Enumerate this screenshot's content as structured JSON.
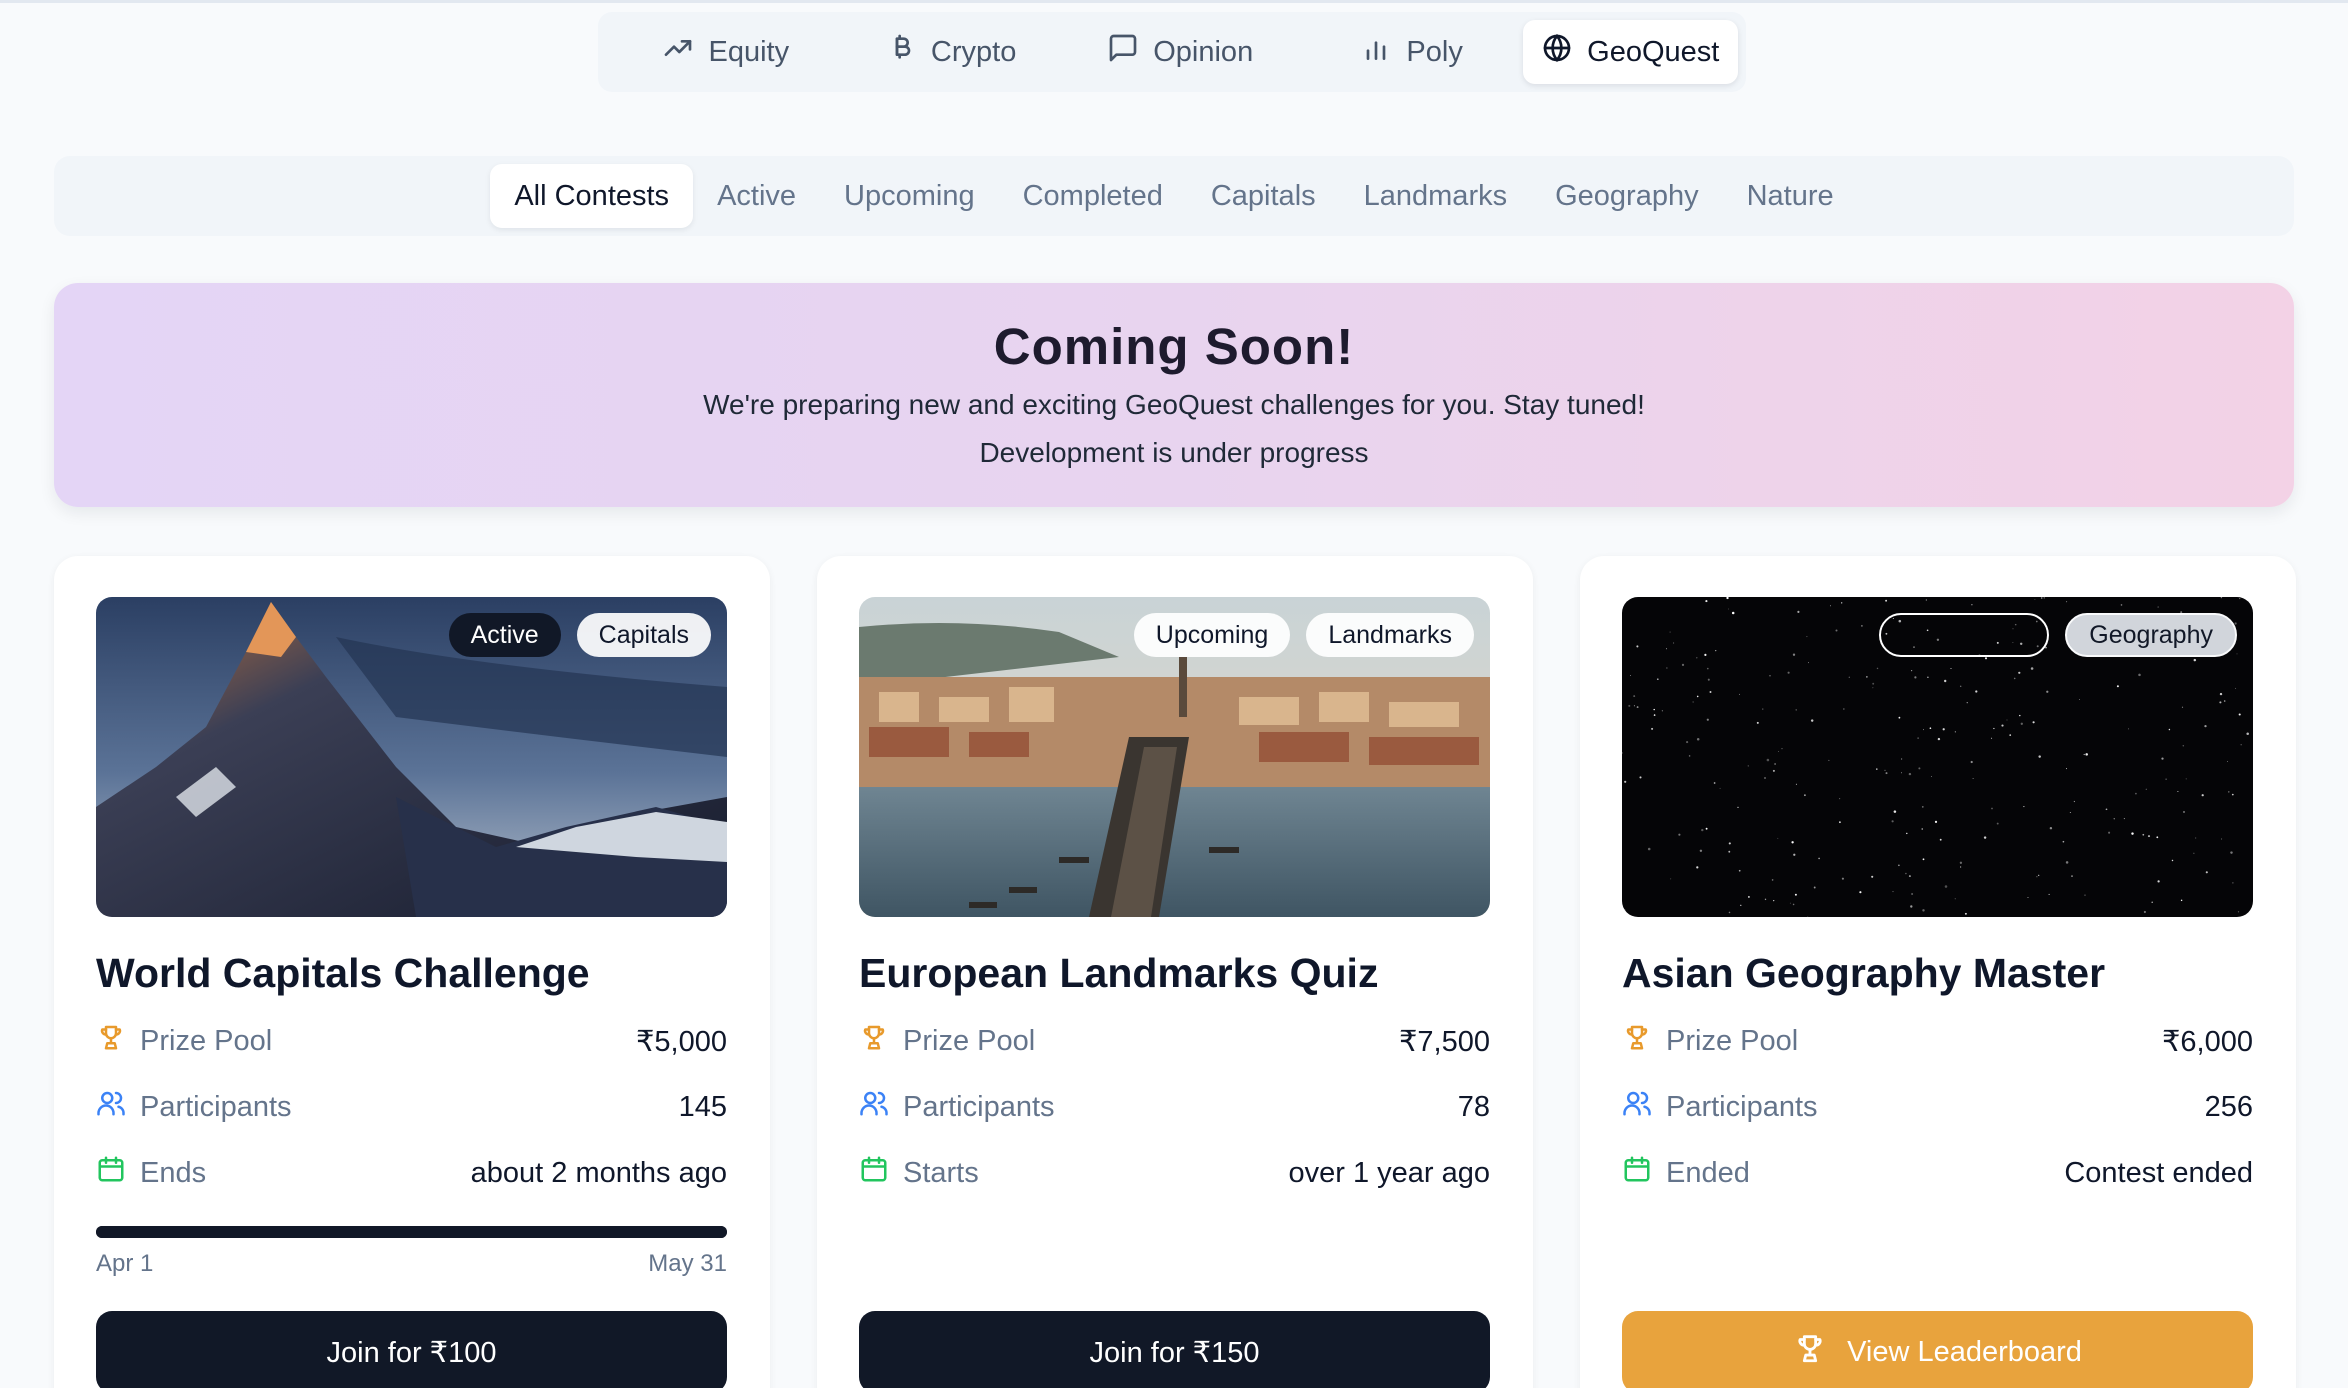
{
  "market_tabs": [
    {
      "label": "Equity",
      "icon": "trending-up-icon"
    },
    {
      "label": "Crypto",
      "icon": "bitcoin-icon"
    },
    {
      "label": "Opinion",
      "icon": "message-square-icon"
    },
    {
      "label": "Poly",
      "icon": "bar-chart-icon"
    },
    {
      "label": "GeoQuest",
      "icon": "globe-icon",
      "active": true
    }
  ],
  "filter_tabs": [
    "All Contests",
    "Active",
    "Upcoming",
    "Completed",
    "Capitals",
    "Landmarks",
    "Geography",
    "Nature"
  ],
  "active_filter": "All Contests",
  "banner": {
    "title": "Coming Soon!",
    "line1": "We're preparing new and exciting GeoQuest challenges for you. Stay tuned!",
    "line2": "Development is under progress"
  },
  "cards": [
    {
      "title": "World Capitals Challenge",
      "status_badge": "Active",
      "category_badge": "Capitals",
      "prize_label": "Prize Pool",
      "prize_value": "₹5,000",
      "participants_label": "Participants",
      "participants_value": "145",
      "time_label": "Ends",
      "time_value": "about 2 months ago",
      "progress_start": "Apr 1",
      "progress_end": "May 31",
      "progress": 1.0,
      "button_label": "Join for ₹100"
    },
    {
      "title": "European Landmarks Quiz",
      "status_badge": "Upcoming",
      "category_badge": "Landmarks",
      "prize_label": "Prize Pool",
      "prize_value": "₹7,500",
      "participants_label": "Participants",
      "participants_value": "78",
      "time_label": "Starts",
      "time_value": "over 1 year ago",
      "button_label": "Join for ₹150"
    },
    {
      "title": "Asian Geography Master",
      "status_badge": "",
      "category_badge": "Geography",
      "prize_label": "Prize Pool",
      "prize_value": "₹6,000",
      "participants_label": "Participants",
      "participants_value": "256",
      "time_label": "Ended",
      "time_value": "Contest ended",
      "button_label": "View Leaderboard"
    }
  ],
  "colors": {
    "accent_dark": "#111827",
    "amber_button": "#e8a33d",
    "trophy_icon": "#e89a2c",
    "users_icon": "#3b82f6",
    "calendar_icon": "#22c55e"
  }
}
